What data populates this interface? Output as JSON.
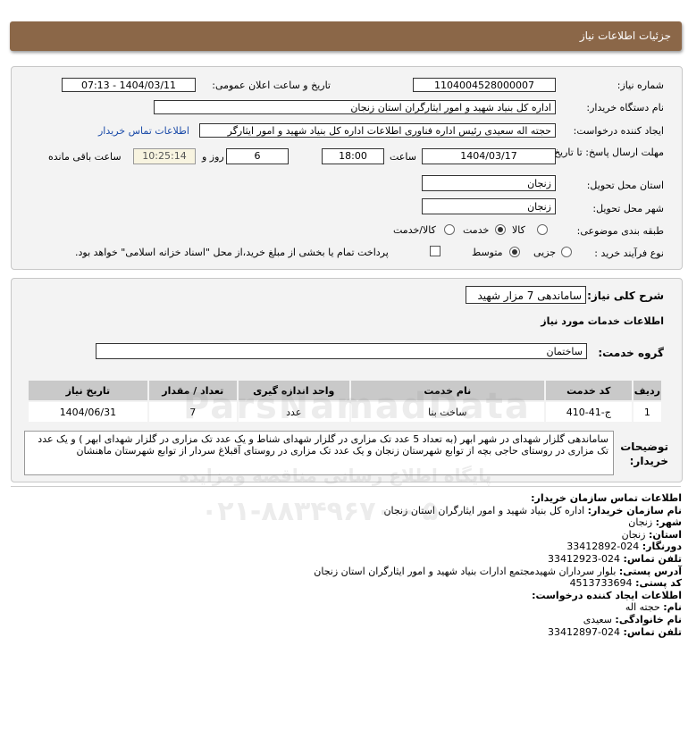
{
  "header": {
    "title": "جزئیات اطلاعات نیاز"
  },
  "need": {
    "need_number_label": "شماره نیاز:",
    "need_number": "1104004528000007",
    "announce_label": "تاریخ و ساعت اعلان عمومی:",
    "announce_value": "1404/03/11 - 07:13",
    "buyer_org_label": "نام دستگاه خریدار:",
    "buyer_org": "اداره کل بنیاد شهید و امور ایثارگران استان زنجان",
    "creator_label": "ایجاد کننده درخواست:",
    "creator": "حجته اله سعیدی رئیس اداره فناوری اطلاعات  اداره کل بنیاد شهید و امور ایثارگر",
    "contact_link": "اطلاعات تماس خریدار",
    "deadline_label": "مهلت ارسال پاسخ: تا تاریخ:",
    "deadline_date": "1404/03/17",
    "time_label": "ساعت",
    "deadline_time": "18:00",
    "days_value": "6",
    "days_label": "روز و",
    "remaining_time": "10:25:14",
    "remaining_label": "ساعت باقی مانده",
    "province_label": "استان محل تحویل:",
    "province": "زنجان",
    "city_label": "شهر محل تحویل:",
    "city": "زنجان",
    "category_label": "طبقه بندی موضوعی:",
    "category_options": [
      "کالا",
      "خدمت",
      "کالا/خدمت"
    ],
    "category_selected": "خدمت",
    "process_label": "نوع فرآیند خرید :",
    "process_options": [
      "جزیی",
      "متوسط"
    ],
    "process_selected": "متوسط",
    "payment_note": "پرداخت تمام یا بخشی از مبلغ خرید،از محل \"اسناد خزانه اسلامی\" خواهد بود."
  },
  "summary": {
    "label": "شرح کلی نیاز:",
    "value": "ساماندهی 7 مزار شهید",
    "services_heading": "اطلاعات خدمات مورد نیاز",
    "group_label": "گروه خدمت:",
    "group_value": "ساختمان"
  },
  "table": {
    "headers": [
      "ردیف",
      "کد خدمت",
      "نام خدمت",
      "واحد اندازه گیری",
      "تعداد / مقدار",
      "تاریخ نیاز"
    ],
    "rows": [
      [
        "1",
        "ج-41-410",
        "ساخت بنا",
        "عدد",
        "7",
        "1404/06/31"
      ]
    ]
  },
  "description": {
    "label": "توضیحات خریدار:",
    "text": "ساماندهی گلزار شهدای در شهر ابهر (به تعداد 5 عدد تک مزاری در گلزار شهدای شناط و یک عدد تک مزاری در گلزار شهدای ابهر ) و یک عدد تک مزاری در روستای حاجی بچه از توابع شهرستان زنجان و یک عدد تک مزاری در روستای آقبلاغ سردار از توابع شهرستان ماهنشان"
  },
  "contact": {
    "heading": "اطلاعات تماس سازمان خریدار:",
    "org_label": "نام سازمان خریدار:",
    "org_value": "اداره کل بنیاد شهید و امور ایثارگران استان زنجان",
    "city_label": "شهر:",
    "city_value": "زنجان",
    "province_label": "استان:",
    "province_value": "زنجان",
    "fax_label": "دورنگار:",
    "fax_value": "024-33412892",
    "phone_label": "تلفن تماس:",
    "phone_value": "024-33412923",
    "address_label": "آدرس پستی:",
    "address_value": "بلوار سرداران شهیدمجتمع ادارات بنیاد شهید و امور ایثارگران استان زنجان",
    "postal_label": "کد پستی:",
    "postal_value": "4513733694",
    "creator_heading": "اطلاعات ایجاد کننده درخواست:",
    "name_label": "نام:",
    "name_value": "حجته اله",
    "family_label": "نام خانوادگی:",
    "family_value": "سعیدی",
    "creator_phone_label": "تلفن تماس:",
    "creator_phone_value": "024-33412897"
  },
  "watermark": {
    "brand": "ParsNamadData",
    "tagline": "پایگاه اطلاع رسانی مناقصه ومزایده",
    "phone": "۰۲۱-۸۸۳۴۹۶۷۰ - ۵"
  }
}
